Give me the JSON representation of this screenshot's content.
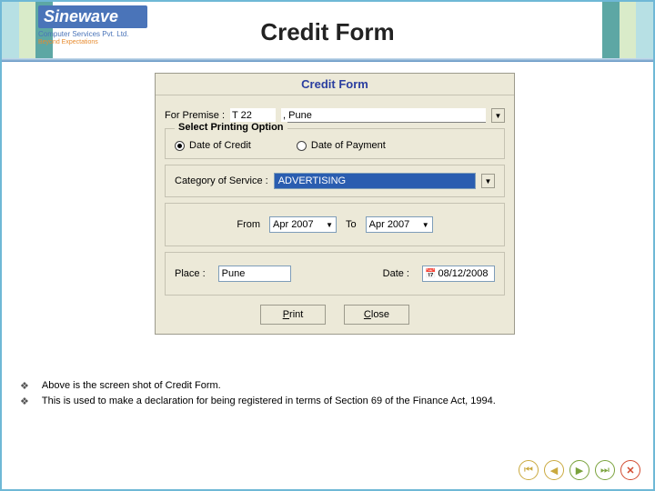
{
  "logo": {
    "brand": "Sinewave",
    "sub": "Computer Services Pvt. Ltd.",
    "tag": "Beyond Expectations"
  },
  "page_title": "Credit Form",
  "dialog": {
    "title": "Credit Form",
    "premise": {
      "label": "For Premise :",
      "value": "T 22",
      "rest": ", Pune"
    },
    "printing": {
      "legend": "Select Printing Option",
      "opt1": "Date of Credit",
      "opt2": "Date of Payment"
    },
    "category": {
      "label": "Category of Service :",
      "value": "ADVERTISING"
    },
    "from": {
      "label": "From",
      "value": "Apr 2007"
    },
    "to": {
      "label": "To",
      "value": "Apr 2007"
    },
    "place": {
      "label": "Place :",
      "value": "Pune"
    },
    "date": {
      "label": "Date :",
      "value": "08/12/2008"
    },
    "buttons": {
      "print_pre": "P",
      "print_post": "rint",
      "close_pre": "C",
      "close_post": "lose"
    }
  },
  "bullets": {
    "mark": "❖",
    "b1": "Above is the screen shot of Credit Form.",
    "b2": "This is used to make a declaration for being registered in terms of Section 69 of the Finance Act, 1994."
  },
  "nav": {
    "first": "⏮",
    "prev": "◀",
    "next": "▶",
    "last": "⏭",
    "close": "✕"
  }
}
